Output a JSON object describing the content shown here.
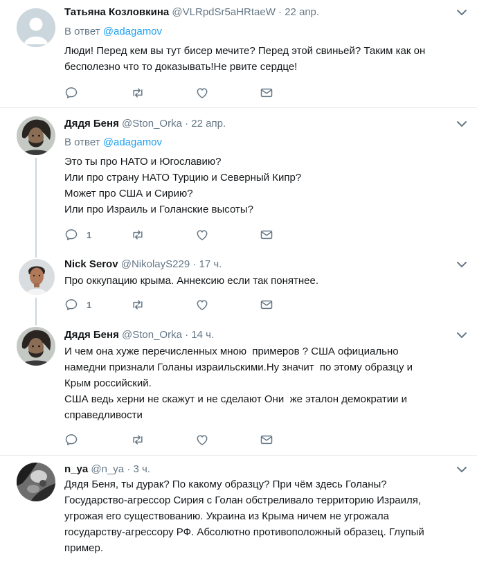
{
  "tweets": [
    {
      "name": "Татьяна Козловкина",
      "handle": "@VLRpdSr5aHRtaeW",
      "time": "22 апр.",
      "reply_prefix": "В ответ ",
      "reply_mention": "@adagamov",
      "lines": [
        "Люди! Перед кем вы тут бисер мечите? Перед этой свиньей? Таким как он",
        "бесполезно что то доказывать!Не рвите сердце!"
      ],
      "reply_count": ""
    },
    {
      "name": "Дядя Беня",
      "handle": "@Ston_Orka",
      "time": "22 апр.",
      "reply_prefix": "В ответ ",
      "reply_mention": "@adagamov",
      "lines": [
        "Это ты про НАТО и Югославию?",
        "Или про страну НАТО Турцию и Северный Кипр?",
        "Может про США и Сирию?",
        "Или про Израиль и Голанские высоты?"
      ],
      "reply_count": "1"
    },
    {
      "name": "Nick Serov",
      "handle": "@NikolayS229",
      "time": "17 ч.",
      "lines": [
        "Про оккупацию крыма. Аннексию если так понятнее."
      ],
      "reply_count": "1"
    },
    {
      "name": "Дядя Беня",
      "handle": "@Ston_Orka",
      "time": "14 ч.",
      "lines": [
        "И чем она хуже перечисленных мною  примеров ? США официально",
        "намедни признали Голаны израильскими.Ну значит  по этому образцу и",
        "Крым российский.",
        "США ведь херни не скажут и не сделают Они  же эталон демократии и",
        "справедливости"
      ],
      "reply_count": ""
    },
    {
      "name": "n_ya",
      "handle": "@n_ya",
      "time": "3 ч.",
      "lines": [
        "Дядя Беня, ты дурак? По какому образцу? При чём здесь Голаны?",
        "Государство-агрессор Сирия с Голан обстреливало территорию Израиля,",
        "угрожая его существованию. Украина из Крыма ничем не угрожала",
        "государству-агрессору РФ. Абсолютно противоположный образец. Глупый",
        "пример."
      ],
      "reply_count": ""
    }
  ],
  "header_separator": "·",
  "icons": [
    "chevron-down-icon",
    "reply-icon",
    "retweet-icon",
    "like-icon",
    "direct-message-icon",
    "avatar"
  ],
  "colors": {
    "text": "#14171a",
    "secondary": "#657786",
    "link": "#1da1f2",
    "icon": "#657786",
    "divider": "#e6ecf0"
  }
}
